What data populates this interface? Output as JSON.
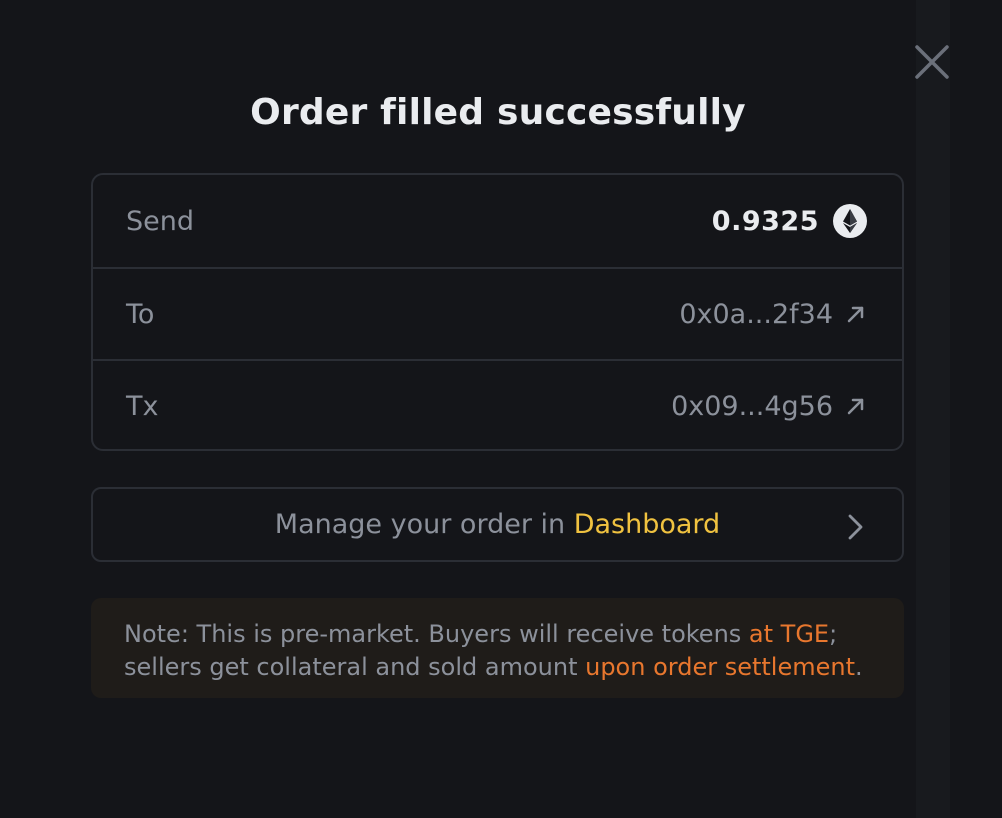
{
  "modal": {
    "title": "Order filled successfully",
    "close_icon": "close-icon"
  },
  "details": {
    "send": {
      "label": "Send",
      "value": "0.9325",
      "icon": "ethereum-icon"
    },
    "to": {
      "label": "To",
      "value": "0x0a...2f34",
      "icon": "external-link-arrow-icon"
    },
    "tx": {
      "label": "Tx",
      "value": "0x09...4g56",
      "icon": "external-link-arrow-icon"
    }
  },
  "manage": {
    "text": "Manage your order in ",
    "link": "Dashboard",
    "icon": "chevron-right-icon"
  },
  "note": {
    "part1": "Note: This is pre-market. Buyers will receive tokens ",
    "highlight1": "at TGE",
    "part2": "; sellers get collateral and sold amount ",
    "highlight2": "upon order settlement",
    "part3": "."
  },
  "colors": {
    "background": "#141519",
    "border": "#2b2e35",
    "text_primary": "#eaecef",
    "text_secondary": "#8c919b",
    "link_yellow": "#f0c240",
    "highlight_orange": "#e8772e",
    "note_background": "#1f1c19"
  }
}
